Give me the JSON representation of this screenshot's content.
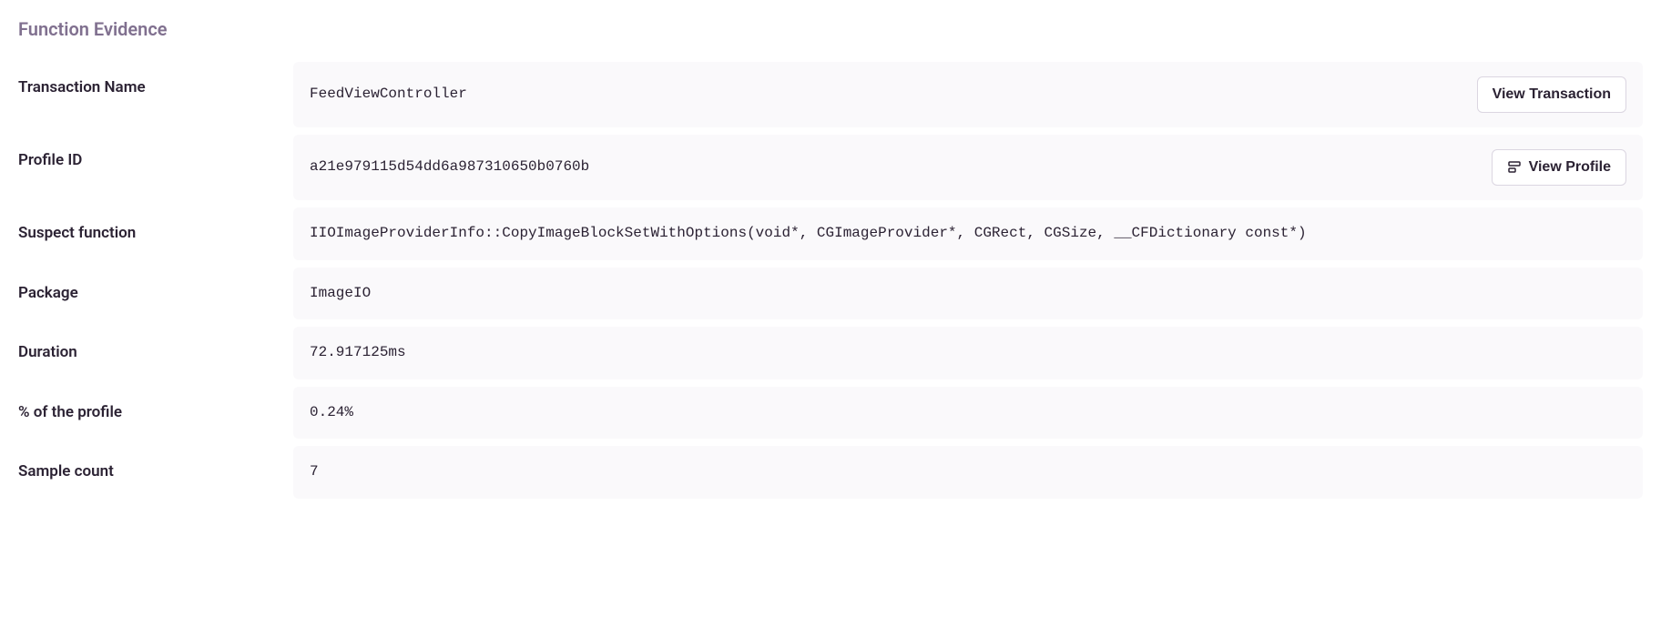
{
  "section_title": "Function Evidence",
  "rows": {
    "transaction_name": {
      "label": "Transaction Name",
      "value": "FeedViewController",
      "button": "View Transaction"
    },
    "profile_id": {
      "label": "Profile ID",
      "value": "a21e979115d54dd6a987310650b0760b",
      "button": "View Profile"
    },
    "suspect_function": {
      "label": "Suspect function",
      "value": "IIOImageProviderInfo::CopyImageBlockSetWithOptions(void*, CGImageProvider*, CGRect, CGSize, __CFDictionary const*)"
    },
    "package": {
      "label": "Package",
      "value": "ImageIO"
    },
    "duration": {
      "label": "Duration",
      "value": "72.917125ms"
    },
    "percent_profile": {
      "label": "% of the profile",
      "value": "0.24%"
    },
    "sample_count": {
      "label": "Sample count",
      "value": "7"
    }
  }
}
